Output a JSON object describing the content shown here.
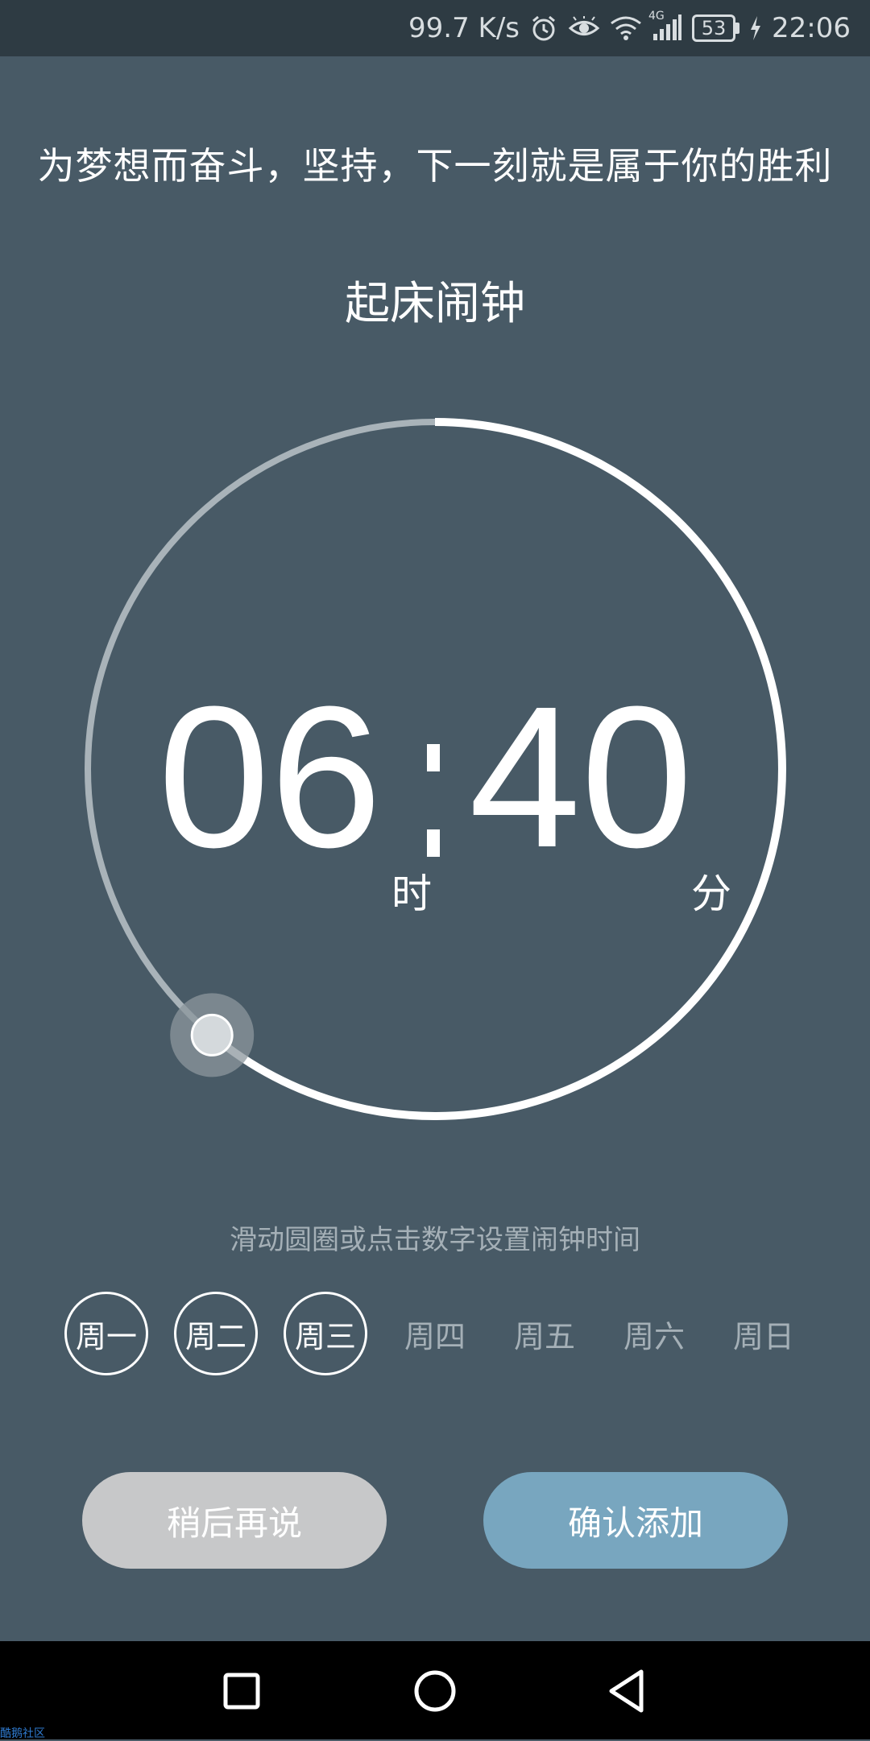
{
  "status_bar": {
    "speed": "99.7 K/s",
    "network": "4G",
    "battery": "53",
    "time": "22:06"
  },
  "motto": "为梦想而奋斗，坚持，下一刻就是属于你的胜利",
  "alarm_title": "起床闹钟",
  "time": {
    "hours": "06",
    "minutes": "40",
    "hour_unit": "时",
    "minute_unit": "分"
  },
  "dial": {
    "progress_fraction": 0.611,
    "active_color": "#ffffff",
    "inactive_color": "#a9b3b9"
  },
  "hint": "滑动圆圈或点击数字设置闹钟时间",
  "weekdays": [
    {
      "label": "周一",
      "selected": true
    },
    {
      "label": "周二",
      "selected": true
    },
    {
      "label": "周三",
      "selected": true
    },
    {
      "label": "周四",
      "selected": false
    },
    {
      "label": "周五",
      "selected": false
    },
    {
      "label": "周六",
      "selected": false
    },
    {
      "label": "周日",
      "selected": false
    }
  ],
  "buttons": {
    "later": "稍后再说",
    "confirm": "确认添加"
  },
  "colors": {
    "background": "#485a66",
    "confirm": "#78a6bf",
    "later": "#c7c8c9"
  },
  "watermark": "酷鹅社区"
}
